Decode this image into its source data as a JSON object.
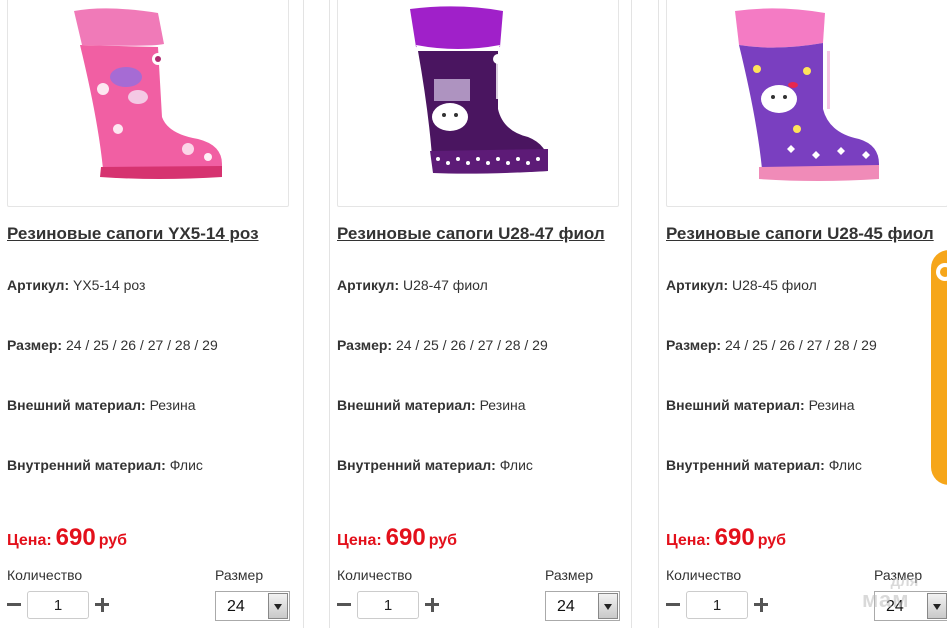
{
  "products": [
    {
      "title": "Резиновые сапоги YX5-14 роз",
      "article_label": "Артикул:",
      "article": "YX5-14 роз",
      "size_label": "Размер:",
      "sizes": "24 / 25 / 26 / 27 / 28 / 29",
      "outer_label": "Внешний материал:",
      "outer": "Резина",
      "inner_label": "Внутренний материал:",
      "inner": "Флис",
      "price_label": "Цена:",
      "price": "690",
      "currency": "руб",
      "qty_label": "Количество",
      "qty_value": "1",
      "size_select_label": "Размер",
      "size_selected": "24",
      "image_icon": "pink-butterfly-rain-boot"
    },
    {
      "title": "Резиновые сапоги U28-47 фиол",
      "article_label": "Артикул:",
      "article": "U28-47 фиол",
      "size_label": "Размер:",
      "sizes": "24 / 25 / 26 / 27 / 28 / 29",
      "outer_label": "Внешний материал:",
      "outer": "Резина",
      "inner_label": "Внутренний материал:",
      "inner": "Флис",
      "price_label": "Цена:",
      "price": "690",
      "currency": "руб",
      "qty_label": "Количество",
      "qty_value": "1",
      "size_select_label": "Размер",
      "size_selected": "24",
      "image_icon": "dark-purple-kitty-rain-boot"
    },
    {
      "title": "Резиновые сапоги U28-45 фиол",
      "article_label": "Артикул:",
      "article": "U28-45 фиол",
      "size_label": "Размер:",
      "sizes": "24 / 25 / 26 / 27 / 28 / 29",
      "outer_label": "Внешний материал:",
      "outer": "Резина",
      "inner_label": "Внутренний материал:",
      "inner": "Флис",
      "price_label": "Цена:",
      "price": "690",
      "currency": "руб",
      "qty_label": "Количество",
      "qty_value": "1",
      "size_select_label": "Размер",
      "size_selected": "24",
      "image_icon": "violet-kitty-rain-boot"
    }
  ],
  "watermark": {
    "line1": "для",
    "line2": "мам"
  },
  "colors": {
    "price_red": "#e3101b",
    "side_badge_orange": "#f6a61a",
    "card_border": "#e3e3e3"
  }
}
